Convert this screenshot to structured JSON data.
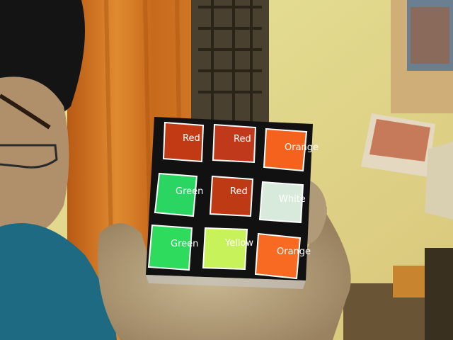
{
  "detections": [
    {
      "row": 1,
      "col": 1,
      "label": "Red",
      "fill": "#c23a14"
    },
    {
      "row": 1,
      "col": 2,
      "label": "Red",
      "fill": "#c0391a"
    },
    {
      "row": 1,
      "col": 3,
      "label": "Orange",
      "fill": "#f4621e"
    },
    {
      "row": 2,
      "col": 1,
      "label": "Green",
      "fill": "#2bd561"
    },
    {
      "row": 2,
      "col": 2,
      "label": "Red",
      "fill": "#be3a14"
    },
    {
      "row": 2,
      "col": 3,
      "label": "White",
      "fill": "#d8eadb"
    },
    {
      "row": 3,
      "col": 1,
      "label": "Green",
      "fill": "#2edb5c"
    },
    {
      "row": 3,
      "col": 2,
      "label": "Yellow",
      "fill": "#c8f25a"
    },
    {
      "row": 3,
      "col": 3,
      "label": "Orange",
      "fill": "#f86a22"
    }
  ],
  "colors": {
    "box_outline": "#ffffff",
    "label_text": "#ffffff",
    "cube_body": "#111111"
  }
}
